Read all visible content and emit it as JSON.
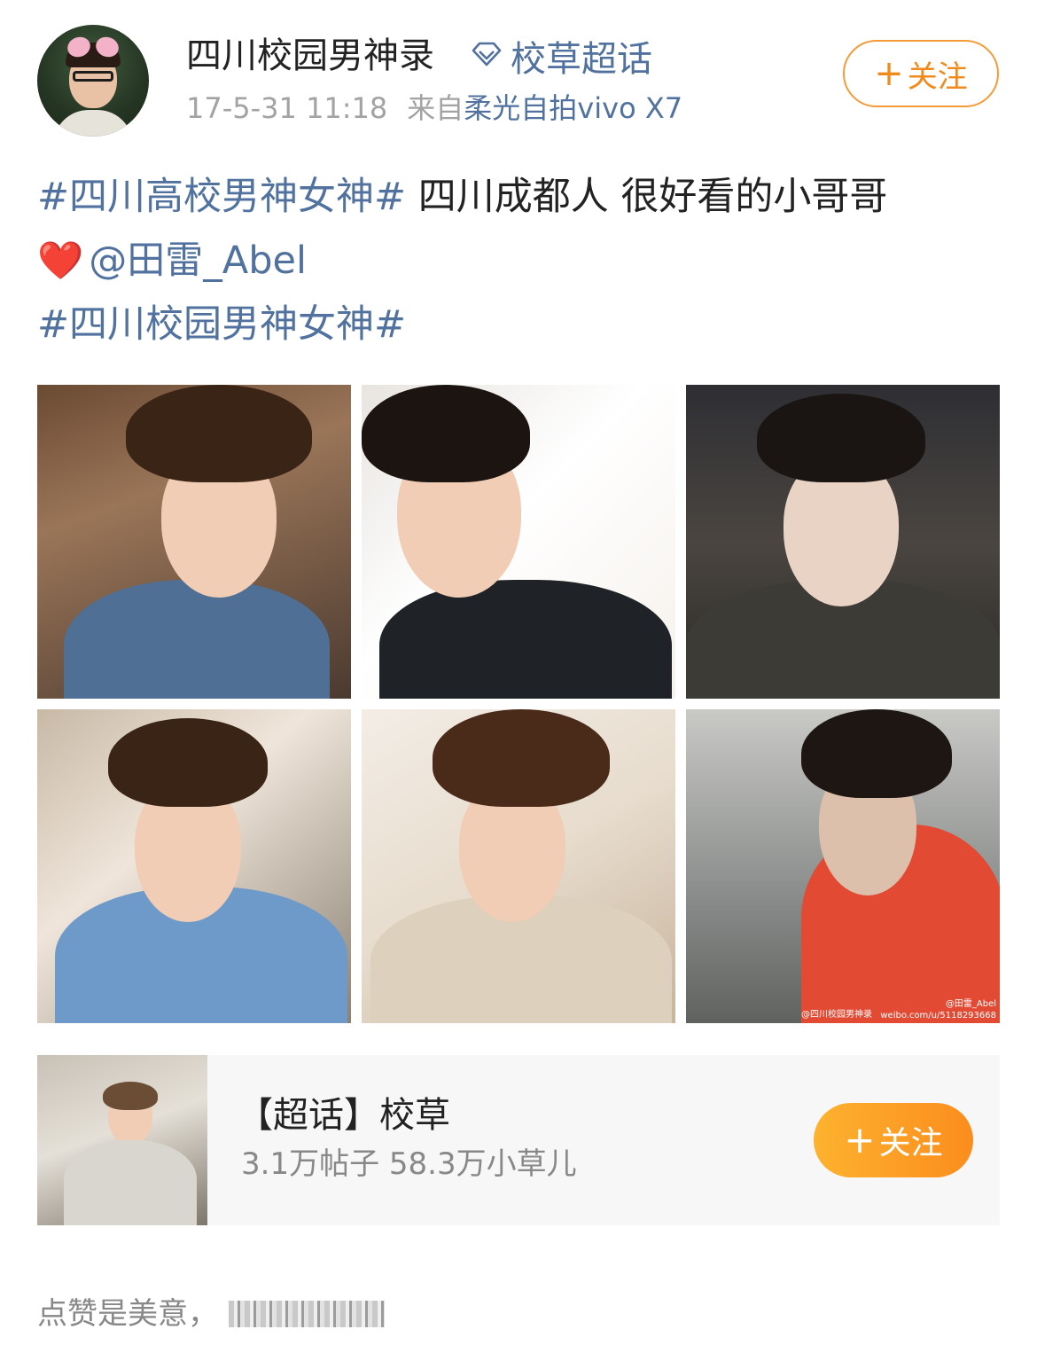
{
  "header": {
    "username": "四川校园男神录",
    "chaohua_label": "校草超话",
    "timestamp": "17-5-31 11:18",
    "from_label": "来自",
    "source": "柔光自拍vivo X7",
    "follow_plus": "+",
    "follow_label": "关注"
  },
  "post": {
    "line1_hashtag": "#四川高校男神女神#",
    "line1_text": " 四川成都人 很好看的小哥哥",
    "line2_heart": "❤️",
    "line2_mention": "@田雷_Abel",
    "line3_hashtag": "#四川校园男神女神#"
  },
  "photos": {
    "watermark_account": "@四川校园男神录",
    "watermark_mention": "@田雷_Abel",
    "watermark_url": "weibo.com/u/5118293668"
  },
  "topic_card": {
    "title": "【超话】校草",
    "stats": "3.1万帖子 58.3万小草儿",
    "follow_plus": "+",
    "follow_label": "关注"
  },
  "footer": {
    "text": "点赞是美意，"
  },
  "colors": {
    "link": "#51729e",
    "accent_orange": "#f08a1c",
    "button_gradient_start": "#fdb22f",
    "button_gradient_end": "#fb8d1d"
  },
  "icons": {
    "chaohua": "diamond-icon",
    "heart": "heart-icon"
  }
}
